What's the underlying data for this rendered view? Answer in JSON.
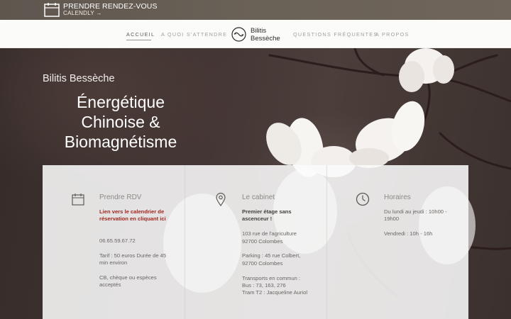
{
  "topbar": {
    "line1": "PRENDRE RENDEZ-VOUS",
    "line2": "CALENDLY →",
    "icon": "calendar-icon"
  },
  "nav": {
    "items": [
      {
        "label": "ACCUEIL",
        "active": true
      },
      {
        "label": "A QUOI S'ATTENDRE",
        "active": false
      },
      {
        "label": "QUESTIONS FRÉQUENTES",
        "active": false
      },
      {
        "label": "A PROPOS",
        "active": false
      }
    ],
    "brand": {
      "line1": "Bilitis",
      "line2": "Bessèche",
      "icon": "yin-yang-logo-icon"
    }
  },
  "hero": {
    "name": "Bilitis Bessèche",
    "title_lines": [
      "Énergétique",
      "Chinoise &",
      "Biomagnétisme"
    ]
  },
  "columns": [
    {
      "icon": "calendar-icon",
      "heading": "Prendre RDV",
      "link": "Lien vers le calendrier de réservation en cliquant ici",
      "phone": "06.65.59.67.72",
      "tarif": "Tarif : 50 euros Durée de 45 min environ",
      "payment": "CB, chèque ou espèces acceptés"
    },
    {
      "icon": "location-pin-icon",
      "heading": "Le cabinet",
      "highlight": "Premier étage sans ascenceur !",
      "address": "103 rue de l'agriculture 92700 Colombes",
      "parking": "Parking : 45 rue Colbert, 92700 Colombes",
      "transport_title": "Transports en commun :",
      "bus": "Bus : 73, 163, 276",
      "tram": "Tram T2 : Jacqueline Auriol"
    },
    {
      "icon": "clock-icon",
      "heading": "Horaires",
      "weekdays": "Du lundi au jeudi : 10h00 - 19h00",
      "friday": "Vendredi : 10h - 16h"
    }
  ],
  "colors": {
    "accent_link": "#a2261e",
    "topbar_bg": "#665d54",
    "nav_bg": "#fbfbfa"
  }
}
